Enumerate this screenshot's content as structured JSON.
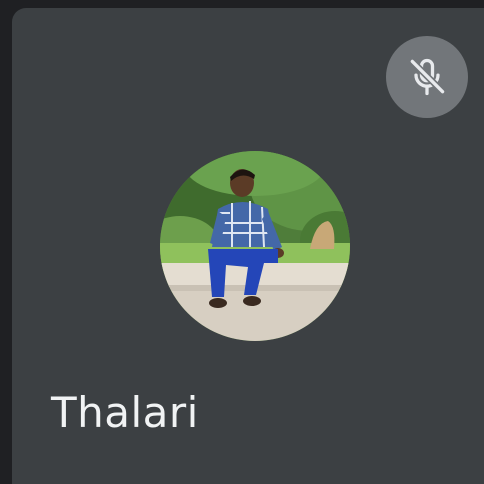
{
  "participant": {
    "name": "Thalari",
    "mic_state_icon": "mic-off-icon",
    "avatar": "profile-photo"
  },
  "colors": {
    "tile_background": "#3c4043",
    "page_background": "#1f2023",
    "mute_badge": "#72767a",
    "name_text": "#f1f3f4"
  }
}
